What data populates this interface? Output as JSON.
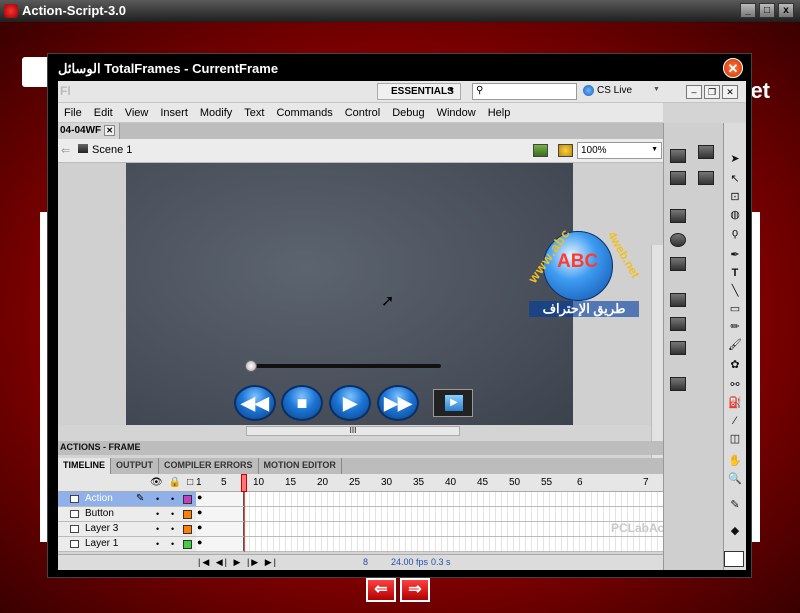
{
  "outer": {
    "title": "Action-Script-3.0",
    "brand_partial": "et",
    "controls": [
      "_",
      "□",
      "x"
    ],
    "nav_prev": "⇐",
    "nav_next": "⇒"
  },
  "dialog": {
    "title": "الوسائل TotalFrames - CurrentFrame",
    "close": "✕"
  },
  "flash": {
    "app_abbrev": "Fl",
    "workspace": "ESSENTIALS",
    "search_icon": "⚲",
    "cs_live": "CS Live",
    "menu": [
      "File",
      "Edit",
      "View",
      "Insert",
      "Modify",
      "Text",
      "Commands",
      "Control",
      "Debug",
      "Window",
      "Help"
    ],
    "doc_tab": "04-04WF",
    "doc_tab_close": "✕",
    "scene": "Scene 1",
    "zoom": "100%",
    "hscroll_grip": "III",
    "player": {
      "rewind": "◀◀",
      "stop": "■",
      "play": "▶",
      "forward": "▶▶",
      "film_play": "▶",
      "progress": 0.0
    },
    "logo": {
      "url_text": "www.abc4web.net",
      "url_left": "www.abc",
      "url_right": "4web.net",
      "abc": "ABC",
      "arabic": "طريق الإحتراف"
    },
    "actions_panel": "ACTIONS - FRAME",
    "timeline_tabs": [
      "TIMELINE",
      "OUTPUT",
      "COMPILER ERRORS",
      "MOTION EDITOR"
    ],
    "ruler": [
      "1",
      "5",
      "10",
      "15",
      "20",
      "25",
      "30",
      "35",
      "40",
      "45",
      "50",
      "55",
      "6",
      "7"
    ],
    "layers": [
      {
        "name": "Action",
        "color": "#c040c0"
      },
      {
        "name": "Button",
        "color": "#ff7f00"
      },
      {
        "name": "Layer 3",
        "color": "#ff7f00"
      },
      {
        "name": "Layer 1",
        "color": "#40d040"
      }
    ],
    "footer": {
      "controls": "|◀ ◀| ▶ |▶ ▶|",
      "frame": "8",
      "fps": "24.00 fps",
      "time": "0.3 s"
    },
    "watermark": "PCLabAcademy.com"
  }
}
